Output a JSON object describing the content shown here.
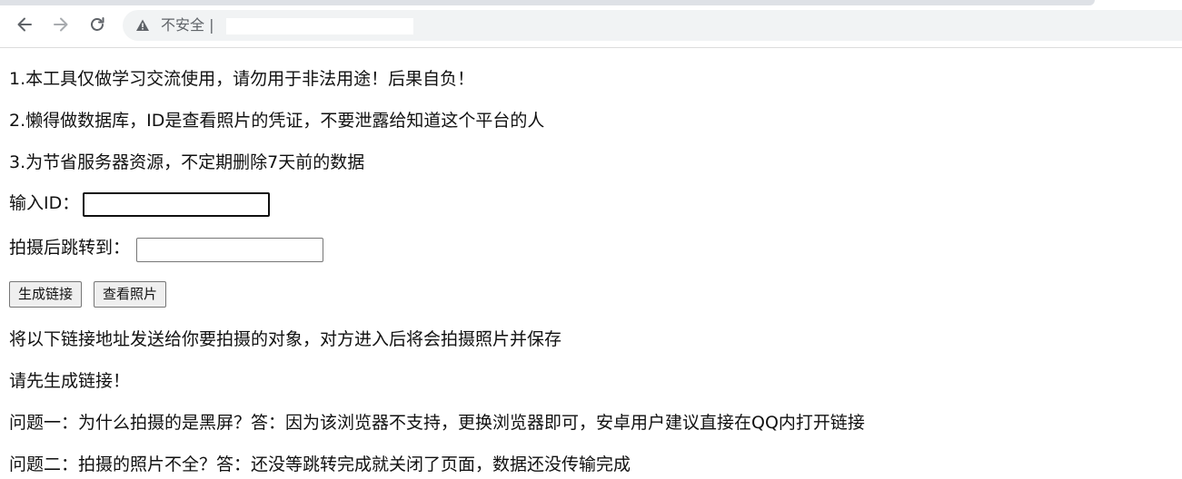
{
  "browser": {
    "security_label": "不安全 |",
    "back_icon": "arrow-left-icon",
    "forward_icon": "arrow-right-icon",
    "reload_icon": "reload-icon",
    "warning_icon": "warning-triangle-icon"
  },
  "notices": {
    "line1": "1.本工具仅做学习交流使用，请勿用于非法用途！后果自负！",
    "line2": "2.懒得做数据库，ID是查看照片的凭证，不要泄露给知道这个平台的人",
    "line3": "3.为节省服务器资源，不定期删除7天前的数据"
  },
  "form": {
    "id_label": "输入ID：",
    "id_value": "",
    "redirect_label": "拍摄后跳转到：",
    "redirect_value": "",
    "generate_button": "生成链接",
    "view_button": "查看照片"
  },
  "result": {
    "instruction": "将以下链接地址发送给你要拍摄的对象，对方进入后将会拍摄照片并保存",
    "placeholder_text": "请先生成链接！"
  },
  "faq": {
    "q1": "问题一：为什么拍摄的是黑屏？答：因为该浏览器不支持，更换浏览器即可，安卓用户建议直接在QQ内打开链接",
    "q2": "问题二：拍摄的照片不全？答：还没等跳转完成就关闭了页面，数据还没传输完成"
  },
  "colors": {
    "omnibox_bg": "#f1f3f4",
    "icon_gray": "#5f6368"
  }
}
